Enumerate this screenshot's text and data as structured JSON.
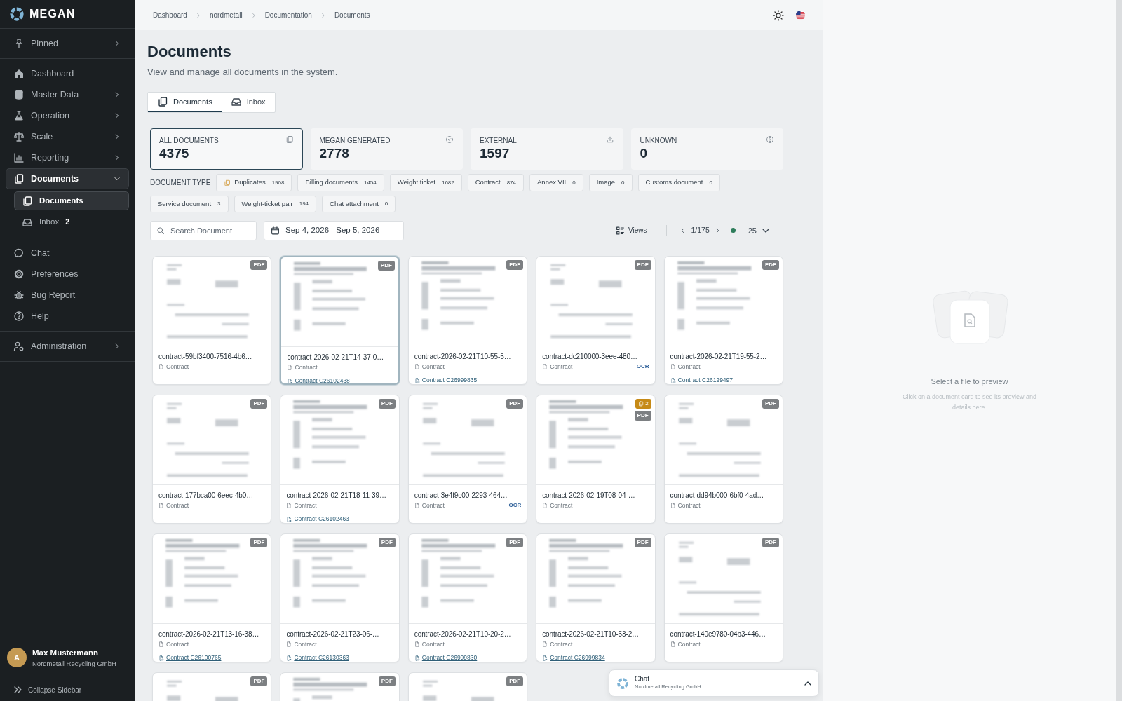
{
  "sidebar": {
    "logo": "MEGAN",
    "sections": [
      [
        {
          "label": "Pinned",
          "selected": false,
          "expanded": false
        }
      ],
      [
        {
          "label": "Dashboard",
          "selected": false
        },
        {
          "label": "Master Data",
          "selected": false,
          "expanded": false
        },
        {
          "label": "Operation",
          "selected": false,
          "expanded": false
        },
        {
          "label": "Scale",
          "selected": false,
          "expanded": false
        },
        {
          "label": "Reporting",
          "selected": false,
          "expanded": false
        },
        {
          "label": "Documents",
          "selected": true,
          "expanded": true,
          "children": [
            {
              "label": "Documents",
              "selected": true
            },
            {
              "label": "Inbox",
              "selected": false,
              "badge": "2"
            }
          ]
        }
      ],
      [
        {
          "label": "Chat",
          "selected": false
        },
        {
          "label": "Preferences",
          "selected": false
        },
        {
          "label": "Bug Report",
          "selected": false
        },
        {
          "label": "Help",
          "selected": false
        }
      ],
      [
        {
          "label": "Administration",
          "selected": false,
          "expanded": false
        }
      ]
    ],
    "user": {
      "initial": "A",
      "name": "Max Mustermann",
      "company": "Nordmetall Recycling GmbH"
    },
    "collapse": "Collapse Sidebar"
  },
  "breadcrumb": [
    "Dashboard",
    "nordmetall",
    "Documentation",
    "Documents"
  ],
  "page": {
    "title": "Documents",
    "subtitle": "View and manage all documents in the system."
  },
  "tabs": [
    {
      "label": "Documents",
      "selected": true
    },
    {
      "label": "Inbox",
      "selected": false
    }
  ],
  "stats": [
    {
      "label": "ALL DOCUMENTS",
      "value": "4375",
      "selected": true
    },
    {
      "label": "MEGAN GENERATED",
      "value": "2778",
      "selected": false
    },
    {
      "label": "EXTERNAL",
      "value": "1597",
      "selected": false
    },
    {
      "label": "UNKNOWN",
      "value": "0",
      "selected": false
    }
  ],
  "document_type": {
    "label": "DOCUMENT TYPE",
    "chips": [
      {
        "kind": "duplicates",
        "label": "Duplicates",
        "count": "1908"
      },
      {
        "kind": "type",
        "label": "Billing documents",
        "count": "1454"
      },
      {
        "kind": "type",
        "label": "Weight ticket",
        "count": "1682"
      },
      {
        "kind": "type",
        "label": "Contract",
        "count": "874"
      },
      {
        "kind": "type",
        "label": "Annex VII",
        "count": "0"
      },
      {
        "kind": "type",
        "label": "Image",
        "count": "0"
      },
      {
        "kind": "type",
        "label": "Customs document",
        "count": "0"
      },
      {
        "kind": "type",
        "label": "Service document",
        "count": "3"
      },
      {
        "kind": "type",
        "label": "Weight-ticket pair",
        "count": "194"
      },
      {
        "kind": "type",
        "label": "Chat attachment",
        "count": "0"
      }
    ]
  },
  "toolbar": {
    "search": {
      "placeholder": "Search Document"
    },
    "date_range": "Sep 4, 2026 - Sep 5, 2026",
    "views": "Views",
    "page": "1/175",
    "connected": true,
    "page_size": "25"
  },
  "documents": [
    {
      "name": "contract-59bf3400-7516-4b6…",
      "type": "Contract",
      "badge": "PDF",
      "selected": false
    },
    {
      "name": "contract-2026-02-21T14-37-0…",
      "type": "Contract",
      "link": "Contract C26102438",
      "badge": "PDF",
      "selected": true
    },
    {
      "name": "contract-2026-02-21T10-55-5…",
      "type": "Contract",
      "link": "Contract C26999835",
      "badge": "PDF",
      "selected": false
    },
    {
      "name": "contract-dc210000-3eee-480…",
      "type": "Contract",
      "tag": "OCR",
      "badge": "PDF",
      "selected": false
    },
    {
      "name": "contract-2026-02-21T19-55-2…",
      "type": "Contract",
      "link": "Contract C26129497",
      "badge": "PDF",
      "selected": false
    },
    {
      "name": "contract-177bca00-6eec-4b0…",
      "type": "Contract",
      "badge": "PDF",
      "selected": false
    },
    {
      "name": "contract-2026-02-21T18-11-39…",
      "type": "Contract",
      "link": "Contract C26102463",
      "badge": "PDF",
      "selected": false
    },
    {
      "name": "contract-3e4f9c00-2293-464…",
      "type": "Contract",
      "tag": "OCR",
      "badge": "PDF",
      "selected": false
    },
    {
      "name": "contract-2026-02-19T08-04-…",
      "type": "Contract",
      "duplicates": "2",
      "badge": "PDF",
      "selected": false
    },
    {
      "name": "contract-dd94b000-6bf0-4ad…",
      "type": "Contract",
      "badge": "PDF",
      "selected": false
    },
    {
      "name": "contract-2026-02-21T13-16-38…",
      "type": "Contract",
      "link": "Contract C26100765",
      "badge": "PDF",
      "selected": false
    },
    {
      "name": "contract-2026-02-21T23-06-…",
      "type": "Contract",
      "link": "Contract C26130363",
      "badge": "PDF",
      "selected": false
    },
    {
      "name": "contract-2026-02-21T10-20-2…",
      "type": "Contract",
      "link": "Contract C26999830",
      "badge": "PDF",
      "selected": false
    },
    {
      "name": "contract-2026-02-21T10-53-2…",
      "type": "Contract",
      "link": "Contract C26999834",
      "badge": "PDF",
      "selected": false
    },
    {
      "name": "contract-140e9780-04b3-446…",
      "type": "Contract",
      "badge": "PDF",
      "selected": false
    },
    {
      "badge": "PDF",
      "selected": false
    },
    {
      "badge": "PDF",
      "selected": false
    },
    {
      "badge": "PDF",
      "selected": false
    }
  ],
  "preview": {
    "title": "Select a file to preview",
    "hint": "Click on a document card to see its preview and details here."
  },
  "chat_widget": {
    "title": "Chat",
    "subtitle": "Nordmetall Recycling GmbH"
  }
}
